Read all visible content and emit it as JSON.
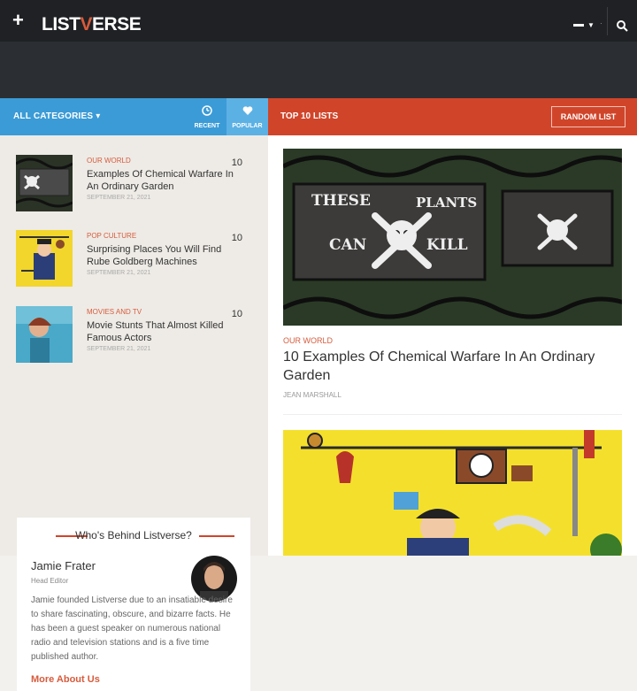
{
  "header": {
    "plus_icon": "plus-icon",
    "logo_left": "LIST",
    "logo_v": "V",
    "logo_right": "ERSE",
    "colors": {
      "bar": "#1f2124",
      "accent": "#d75b3c"
    }
  },
  "category_bar": {
    "label": "ALL CATEGORIES ▾",
    "recent_label": "RECENT",
    "popular_label": "POPULAR",
    "recent_icon": "clock-icon",
    "popular_icon": "heart-icon",
    "color": "#3b9bd6"
  },
  "lists_bar": {
    "label": "TOP 10 LISTS",
    "random_label": "RANDOM LIST",
    "color": "#d0452a"
  },
  "sidebar_items": [
    {
      "category": "OUR WORLD",
      "title": "Examples Of Chemical Warfare In An Ordinary Garden",
      "date": "SEPTEMBER 21, 2021",
      "count": "10"
    },
    {
      "category": "POP CULTURE",
      "title": "Surprising Places You Will Find Rube Goldberg Machines",
      "date": "SEPTEMBER 21, 2021",
      "count": "10"
    },
    {
      "category": "MOVIES AND TV",
      "title": "Movie Stunts That Almost Killed Famous Actors",
      "date": "SEPTEMBER 21, 2021",
      "count": "10"
    }
  ],
  "who": {
    "heading": "Who's Behind Listverse?",
    "name": "Jamie Frater",
    "role": "Head Editor",
    "bio": "Jamie founded Listverse due to an insatiable desire to share fascinating, obscure, and bizarre facts. He has been a guest speaker on numerous national radio and television stations and is a five time published author.",
    "more": "More About Us"
  },
  "main": {
    "category": "OUR WORLD",
    "title": "10 Examples Of Chemical Warfare In An Ordinary Garden",
    "author": "JEAN MARSHALL",
    "hero_sign_text": [
      "THESE",
      "PLANTS",
      "CAN",
      "KILL"
    ]
  }
}
